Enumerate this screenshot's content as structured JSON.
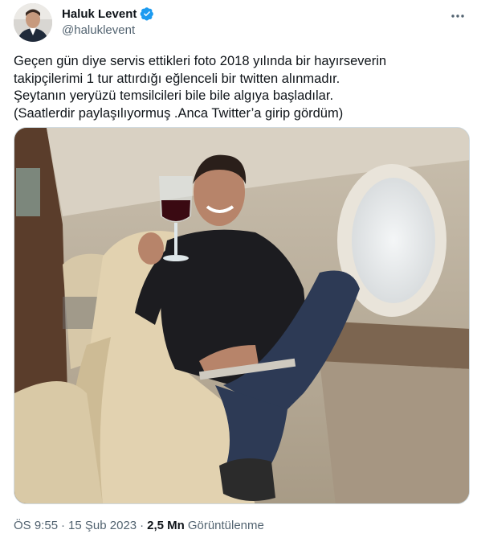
{
  "user": {
    "name": "Haluk Levent",
    "handle": "@haluklevent",
    "verified": true
  },
  "tweet": {
    "text": "Geçen gün diye servis ettikleri foto 2018 yılında bir hayırseverin\ntakipçilerimi 1 tur attırdığı eğlenceli bir twitten alınmadır.\nŞeytanın yeryüzü temsilcileri bile bile algıya başladılar.\n(Saatlerdir paylaşılıyormuş .Anca Twitter’a girip gördüm)",
    "time": "ÖS 9:55",
    "date": "15 Şub 2023",
    "views_count": "2,5 Mn",
    "views_label": "Görüntülenme",
    "separator": "·"
  },
  "icons": {
    "verified": "verified-badge-icon",
    "more": "more-options-icon"
  },
  "colors": {
    "text": "#0f1419",
    "secondary": "#536471",
    "verified": "#1d9bf0",
    "border": "#cfd9de"
  }
}
